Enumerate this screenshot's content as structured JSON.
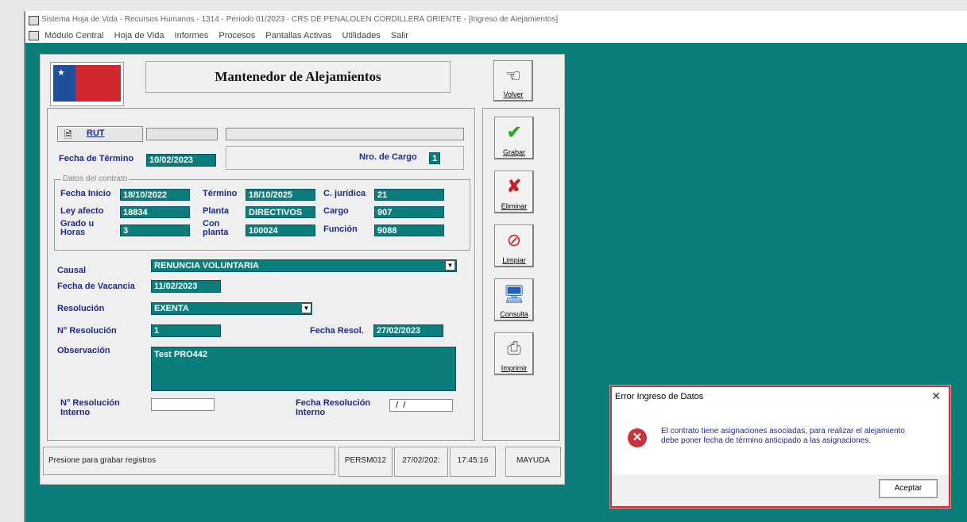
{
  "window": {
    "title": "Sistema Hoja de Vida - Recursos Humanos - 1314 - Periodo 01/2023 - CRS DE PENALOLEN CORDILLERA ORIENTE - [Ingreso de Alejamientos]"
  },
  "menu": [
    "Módulo Central",
    "Hoja de Vida",
    "Informes",
    "Procesos",
    "Pantallas Activas",
    "Utilidades",
    "Salir"
  ],
  "form": {
    "title": "Mantenedor de Alejamientos",
    "buttons": {
      "volver": "Volver",
      "grabar": "Grabar",
      "eliminar": "Eliminar",
      "limpiar": "Limpiar",
      "consulta": "Consulta",
      "imprimir": "Imprimir"
    },
    "rut_label": "RUT",
    "rut_value": "",
    "name_value": "",
    "fecha_termino_label": "Fecha de Término",
    "fecha_termino": "10/02/2023",
    "nro_cargo_label": "Nro. de Cargo",
    "nro_cargo": "1",
    "contrato": {
      "group_title": "Datos del contrato",
      "fecha_inicio_label": "Fecha Inicio",
      "fecha_inicio": "18/10/2022",
      "termino_label": "Término",
      "termino": "18/10/2025",
      "c_juridica_label": "C. jurídica",
      "c_juridica": "21",
      "ley_afecto_label": "Ley afecto",
      "ley_afecto": "18834",
      "planta_label": "Planta",
      "planta": "DIRECTIVOS",
      "cargo_label": "Cargo",
      "cargo": "907",
      "grado_label_1": "Grado u",
      "grado_label_2": "Horas",
      "grado": "3",
      "con_planta_label_1": "Con",
      "con_planta_label_2": "planta",
      "con_planta": "100024",
      "funcion_label": "Función",
      "funcion": "9088"
    },
    "causal_label": "Causal",
    "causal": "RENUNCIA VOLUNTARIA",
    "fecha_vacancia_label": "Fecha de Vacancia",
    "fecha_vacancia": "11/02/2023",
    "resolucion_label": "Resolución",
    "resolucion": "EXENTA",
    "n_resolucion_label": "N° Resolución",
    "n_resolucion": "1",
    "fecha_resol_label": "Fecha Resol.",
    "fecha_resol": "27/02/2023",
    "observacion_label": "Observación",
    "observacion": "Test PRO442",
    "n_res_interno_label_1": "N° Resolución",
    "n_res_interno_label_2": "Interno",
    "n_res_interno": "",
    "fecha_res_interno_label_1": "Fecha Resolución",
    "fecha_res_interno_label_2": "Interno",
    "fecha_res_interno": " /  /"
  },
  "status": {
    "message": "Presione para grabar registros",
    "program": "PERSM012",
    "date": "27/02/202:",
    "time": "17:45:16",
    "caps": "MAYUDA"
  },
  "dialog": {
    "title": "Error Ingreso de Datos",
    "message": "El contrato tiene asignaciones asociadas, para realizar el alejamiento debe poner fecha de término anticipado a las asignaciones.",
    "ok_label": "Aceptar",
    "close": "✕"
  },
  "colors": {
    "teal": "#0b7d7a",
    "label_blue": "#1c2a8a",
    "error_red": "#c8323a"
  }
}
